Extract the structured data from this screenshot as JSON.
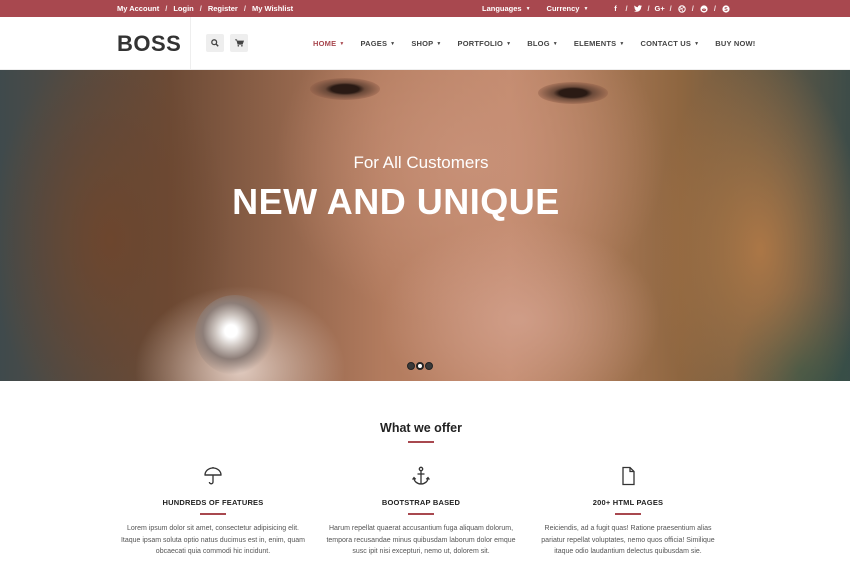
{
  "topbar": {
    "links": [
      "My Account",
      "Login",
      "Register",
      "My Wishlist"
    ],
    "dropdowns": [
      "Languages",
      "Currency"
    ],
    "social": [
      "facebook-icon",
      "twitter-icon",
      "google-plus-icon",
      "dribbble-icon",
      "reddit-icon",
      "skype-icon"
    ],
    "social_glyphs": [
      "f",
      "",
      "G+",
      "",
      "",
      ""
    ],
    "colors": {
      "accent": "#a8484f"
    }
  },
  "header": {
    "logo": "BOSS",
    "nav": [
      {
        "label": "HOME",
        "dropdown": true,
        "active": true
      },
      {
        "label": "PAGES",
        "dropdown": true
      },
      {
        "label": "SHOP",
        "dropdown": true
      },
      {
        "label": "PORTFOLIO",
        "dropdown": true
      },
      {
        "label": "BLOG",
        "dropdown": true
      },
      {
        "label": "ELEMENTS",
        "dropdown": true
      },
      {
        "label": "CONTACT US",
        "dropdown": true
      },
      {
        "label": "BUY NOW!",
        "dropdown": false
      }
    ]
  },
  "hero": {
    "subtitle": "For All Customers",
    "title": "NEW AND UNIQUE",
    "slides": 3,
    "active_slide": 2
  },
  "offer": {
    "title": "What we offer",
    "features": [
      {
        "icon": "umbrella-icon",
        "heading": "HUNDREDS OF FEATURES",
        "lines": [
          "Lorem ipsum dolor sit amet, consectetur adipisicing elit.",
          "Itaque ipsam soluta optio natus ducimus est in, enim, quam",
          "obcaecati quia commodi hic incidunt."
        ]
      },
      {
        "icon": "anchor-icon",
        "heading": "BOOTSTRAP BASED",
        "lines": [
          "Harum repellat quaerat accusantium fuga aliquam dolorum,",
          "tempora recusandae minus quibusdam laborum dolor emque",
          "susc ipit nisi excepturi, nemo ut, dolorem sit."
        ]
      },
      {
        "icon": "document-icon",
        "heading": "200+ HTML PAGES",
        "lines": [
          "Reiciendis, ad a fugit quas! Ratione praesentium alias",
          "pariatur repellat voluptates, nemo quos officia! Similique",
          "itaque odio laudantium delectus quibusdam sie."
        ]
      }
    ]
  }
}
